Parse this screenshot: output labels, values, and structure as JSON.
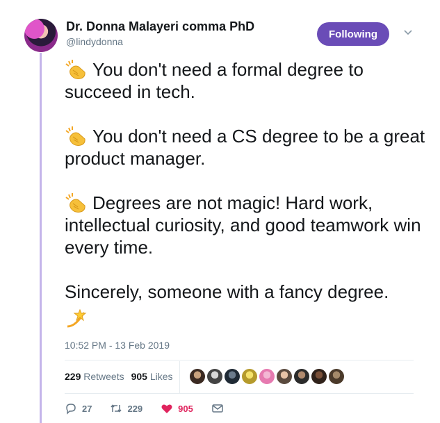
{
  "author": {
    "name": "Dr. Donna Malayeri comma PhD",
    "handle": "@lindydonna"
  },
  "follow_button": {
    "label": "Following",
    "color": "#6a4cb7"
  },
  "tweet": {
    "paragraphs": [
      "You don't need a formal degree to succeed in tech.",
      "You don't need a CS degree to be a great product manager.",
      "Degrees are not magic! Hard work, intellectual curiosity, and good teamwork win every time.",
      "Sincerely, someone with a fancy degree."
    ],
    "emoji": {
      "clap": "clapping-hands",
      "star": "dizzy-star"
    },
    "timestamp": "10:52 PM - 13 Feb 2019"
  },
  "stats": {
    "retweets_count": "229",
    "retweets_label": "Retweets",
    "likes_count": "905",
    "likes_label": "Likes",
    "liker_avatars": 9
  },
  "actions": {
    "replies": "27",
    "retweets": "229",
    "likes": "905",
    "like_color": "#e0245e"
  },
  "colors": {
    "thread_line": "#c4b5ea",
    "muted_text": "#657786"
  }
}
